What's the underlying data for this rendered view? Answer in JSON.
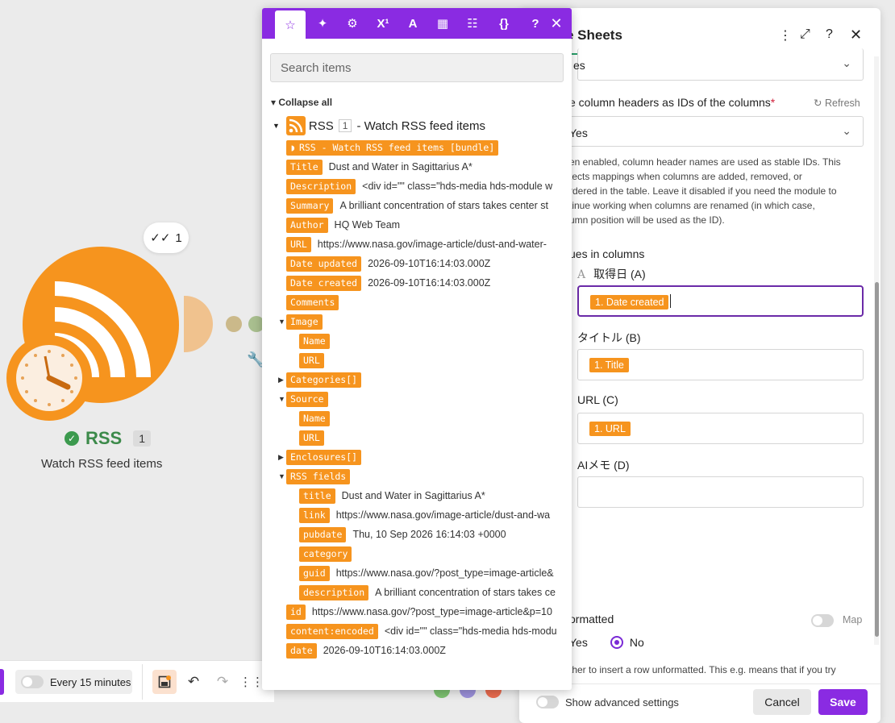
{
  "canvas": {
    "run_count": "1",
    "node": {
      "name": "RSS",
      "count": "1",
      "subtitle": "Watch RSS feed items"
    },
    "schedule_label": "Every 15 minutes"
  },
  "panel": {
    "search_placeholder": "Search items",
    "collapse_label": "Collapse all",
    "feed": {
      "name": "RSS",
      "index": "1",
      "title": "- Watch RSS feed items"
    },
    "bundle_label": "RSS - Watch RSS feed items [bundle]",
    "items": [
      {
        "key": "Title",
        "value": "Dust and Water in Sagittarius A*"
      },
      {
        "key": "Description",
        "value": "<div id=\"\" class=\"hds-media hds-module w"
      },
      {
        "key": "Summary",
        "value": "A brilliant concentration of stars takes center st"
      },
      {
        "key": "Author",
        "value": "HQ Web Team"
      },
      {
        "key": "URL",
        "value": "https://www.nasa.gov/image-article/dust-and-water-"
      },
      {
        "key": "Date updated",
        "value": "2026-09-10T16:14:03.000Z"
      },
      {
        "key": "Date created",
        "value": "2026-09-10T16:14:03.000Z"
      },
      {
        "key": "Comments",
        "value": ""
      }
    ],
    "image": {
      "key": "Image",
      "children": [
        "Name",
        "URL"
      ]
    },
    "categories": "Categories[]",
    "source": {
      "key": "Source",
      "children": [
        "Name",
        "URL"
      ]
    },
    "enclosures": "Enclosures[]",
    "rss_fields": {
      "key": "RSS fields",
      "children": [
        {
          "key": "title",
          "value": "Dust and Water in Sagittarius A*"
        },
        {
          "key": "link",
          "value": "https://www.nasa.gov/image-article/dust-and-wa"
        },
        {
          "key": "pubdate",
          "value": "Thu, 10 Sep 2026 16:14:03 +0000"
        },
        {
          "key": "category",
          "value": ""
        },
        {
          "key": "guid",
          "value": "https://www.nasa.gov/?post_type=image-article&"
        },
        {
          "key": "description",
          "value": "A brilliant concentration of stars takes ce"
        }
      ]
    },
    "tail": [
      {
        "key": "id",
        "value": "https://www.nasa.gov/?post_type=image-article&p=10"
      },
      {
        "key": "content:encoded",
        "value": "<div id=\"\" class=\"hds-media hds-modu"
      },
      {
        "key": "date",
        "value": "2026-09-10T16:14:03.000Z"
      }
    ]
  },
  "sheet": {
    "title": "e Sheets",
    "top_select_value": "es",
    "headers_label": "e column headers as IDs of the columns",
    "required_mark": "*",
    "refresh_label": "Refresh",
    "headers_value": "Yes",
    "hint_lines": [
      "en enabled, column header names are used as stable IDs. This",
      "tects mappings when columns are added, removed, or",
      "rdered in the table. Leave it disabled if you need the module to",
      "tinue working when columns are renamed (in which case,",
      "umn position will be used as the ID)."
    ],
    "values_label": "ues in columns",
    "columns": [
      {
        "label": "取得日 (A)",
        "pill": "1. Date created"
      },
      {
        "label": "タイトル (B)",
        "pill": "1. Title"
      },
      {
        "label": "URL (C)",
        "pill": "1. URL"
      },
      {
        "label": "AIメモ (D)",
        "pill": ""
      }
    ],
    "unformatted_label": "ormatted",
    "map_label": "Map",
    "radio_yes": "Yes",
    "radio_no": "No",
    "unformatted_hint": "ther to insert a row unformatted. This e.g. means that if you try",
    "advanced_label": "Show advanced settings",
    "cancel_label": "Cancel",
    "save_label": "Save"
  }
}
